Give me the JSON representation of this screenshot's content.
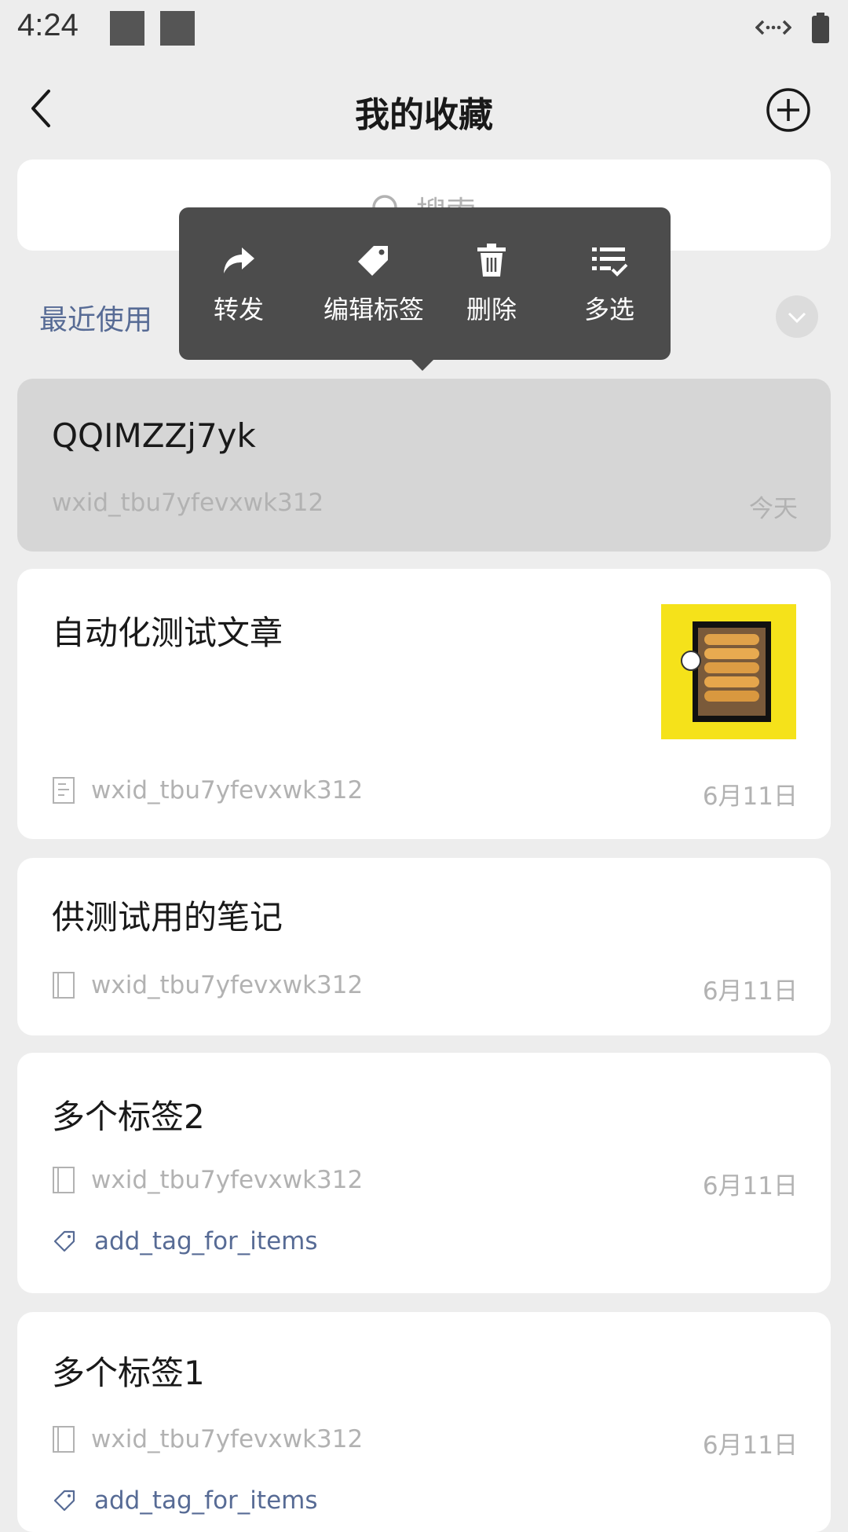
{
  "status_bar": {
    "time": "4:24"
  },
  "header": {
    "title": "我的收藏"
  },
  "search": {
    "placeholder": "搜索"
  },
  "recent": {
    "label": "最近使用"
  },
  "popup_menu": {
    "items": [
      {
        "label": "转发",
        "icon": "forward-icon"
      },
      {
        "label": "编辑标签",
        "icon": "tag-icon"
      },
      {
        "label": "删除",
        "icon": "trash-icon"
      },
      {
        "label": "多选",
        "icon": "multi-select-icon"
      }
    ]
  },
  "items": [
    {
      "title": "QQIMZZj7yk",
      "source": "wxid_tbu7yfevxwk312",
      "date": "今天",
      "selected": true
    },
    {
      "title": "自动化测试文章",
      "source": "wxid_tbu7yfevxwk312",
      "date": "6月11日",
      "type_icon": "article-icon",
      "has_thumbnail": true
    },
    {
      "title": "供测试用的笔记",
      "source": "wxid_tbu7yfevxwk312",
      "date": "6月11日",
      "type_icon": "note-icon"
    },
    {
      "title": "多个标签2",
      "source": "wxid_tbu7yfevxwk312",
      "date": "6月11日",
      "type_icon": "note-icon",
      "tag": "add_tag_for_items"
    },
    {
      "title": "多个标签1",
      "source": "wxid_tbu7yfevxwk312",
      "date": "6月11日",
      "type_icon": "note-icon",
      "tag": "add_tag_for_items"
    }
  ],
  "colors": {
    "accent_link": "#576b95",
    "popup_bg": "#4c4c4c",
    "page_bg": "#ededed"
  }
}
